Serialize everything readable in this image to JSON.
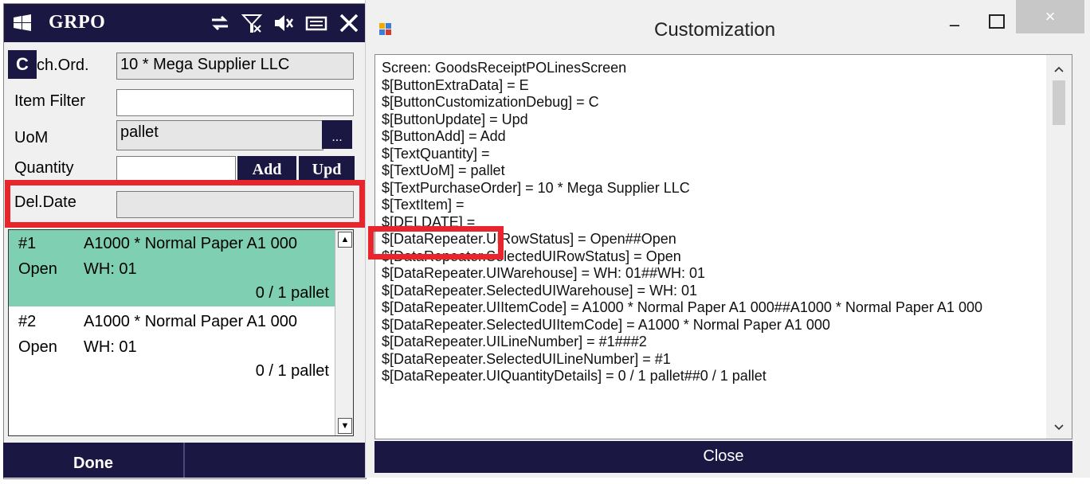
{
  "mobile": {
    "title": "GRPO",
    "c_button": "C",
    "purch_label": "ch.Ord.",
    "purch_value": "10 * Mega Supplier LLC",
    "item_filter_label": "Item Filter",
    "item_filter_value": "",
    "uom_label": "UoM",
    "uom_value": "pallet",
    "uom_lookup": "...",
    "quantity_label": "Quantity",
    "quantity_value": "",
    "add_label": "Add",
    "upd_label": "Upd",
    "deldate_label": "Del.Date",
    "deldate_value": "",
    "rows": [
      {
        "num": "#1",
        "desc": "A1000 * Normal Paper A1 000",
        "status": "Open",
        "wh": "WH: 01",
        "qty": "0 / 1 pallet"
      },
      {
        "num": "#2",
        "desc": "A1000 * Normal Paper A1 000",
        "status": "Open",
        "wh": "WH: 01",
        "qty": "0 / 1 pallet"
      }
    ],
    "done_label": "Done"
  },
  "dialog": {
    "title": "Customization",
    "close_x": "×",
    "minimize": "–",
    "lines": [
      "Screen: GoodsReceiptPOLinesScreen",
      "$[ButtonExtraData] = E",
      "$[ButtonCustomizationDebug] = C",
      "$[ButtonUpdate] = Upd",
      "$[ButtonAdd] = Add",
      "$[TextQuantity] =",
      "$[TextUoM] = pallet",
      "$[TextPurchaseOrder] = 10 * Mega Supplier LLC",
      "$[TextItem] =",
      "$[DELDATE] =",
      "$[DataRepeater.UIRowStatus] = Open##Open",
      "$[DataRepeater.SelectedUIRowStatus] = Open",
      "$[DataRepeater.UIWarehouse] = WH: 01##WH: 01",
      "$[DataRepeater.SelectedUIWarehouse] = WH: 01",
      "$[DataRepeater.UIItemCode] = A1000 * Normal Paper A1 000##A1000 * Normal Paper A1 000",
      "$[DataRepeater.SelectedUIItemCode] = A1000 * Normal Paper A1 000",
      "$[DataRepeater.UILineNumber] = #1###2",
      "$[DataRepeater.SelectedUILineNumber] = #1",
      "$[DataRepeater.UIQuantityDetails] = 0 / 1 pallet##0 / 1 pallet"
    ],
    "close_label": "Close"
  },
  "colors": {
    "navy": "#1a1742",
    "highlight": "#e8252c",
    "selected_row": "#7fd0b2"
  }
}
